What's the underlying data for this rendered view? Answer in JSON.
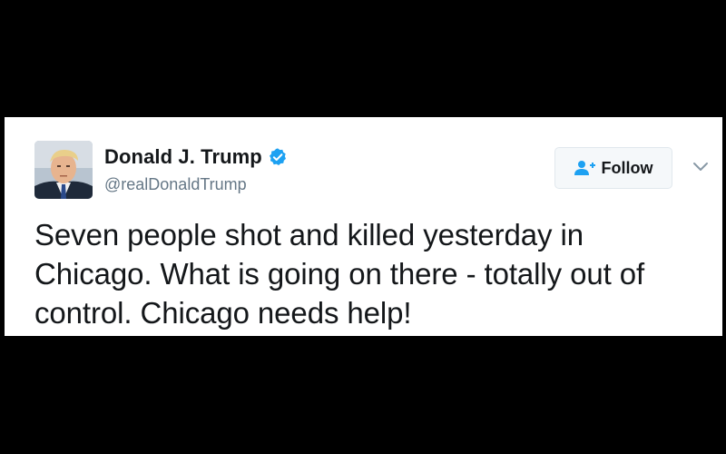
{
  "tweet": {
    "author": {
      "display_name": "Donald J. Trump",
      "handle": "@realDonaldTrump",
      "verified": true,
      "avatar_icon": "profile-photo"
    },
    "follow_button": {
      "label": "Follow",
      "icon": "add-user-icon"
    },
    "menu_icon": "chevron-down-icon",
    "text": "Seven people shot and killed yesterday in Chicago. What is going on there - totally out of control. Chicago needs help!"
  },
  "colors": {
    "background": "#000000",
    "card": "#ffffff",
    "text": "#14171a",
    "secondary_text": "#657786",
    "verified_blue": "#1da1f2",
    "button_border": "#e1e8ed"
  }
}
